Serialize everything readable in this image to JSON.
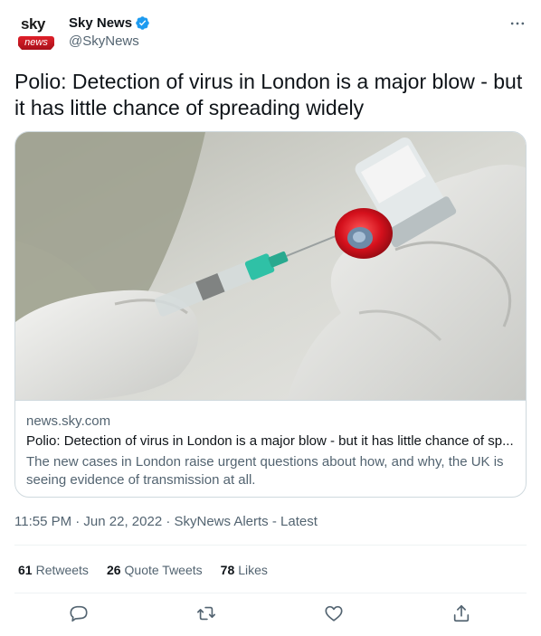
{
  "account": {
    "avatar_top": "sky",
    "avatar_bottom": "news",
    "display_name": "Sky News",
    "handle": "@SkyNews",
    "verified": true
  },
  "tweet": {
    "text": "Polio: Detection of virus in London is a major blow - but it has little chance of spreading widely"
  },
  "card": {
    "domain": "news.sky.com",
    "title": "Polio: Detection of virus in London is a major blow - but it has little chance of sp...",
    "description": "The new cases in London raise urgent questions about how, and why, the UK is seeing evidence of transmission at all."
  },
  "meta": {
    "timestamp": "11:55 PM · Jun 22, 2022 · SkyNews Alerts - Latest"
  },
  "stats": {
    "retweets_count": "61",
    "retweets_label": "Retweets",
    "quotes_count": "26",
    "quotes_label": "Quote Tweets",
    "likes_count": "78",
    "likes_label": "Likes"
  },
  "icons": {
    "more": "more-icon",
    "reply": "reply-icon",
    "retweet": "retweet-icon",
    "like": "like-icon",
    "share": "share-icon",
    "verified": "verified-icon"
  },
  "colors": {
    "verified_blue": "#1d9bf0",
    "text_primary": "#0f1419",
    "text_secondary": "#536471",
    "sky_red": "#e0202a"
  }
}
